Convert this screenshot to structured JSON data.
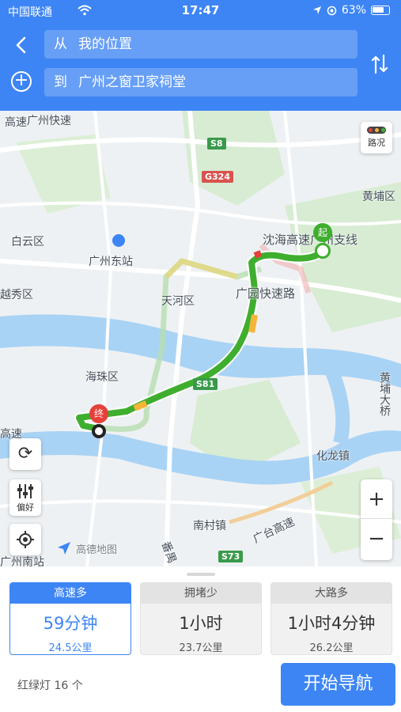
{
  "status_bar": {
    "carrier": "中国联通",
    "time": "17:47",
    "battery": "63%"
  },
  "route_input": {
    "from_prefix": "从",
    "from_value": "我的位置",
    "to_prefix": "到",
    "to_value": "广州之窗卫家祠堂"
  },
  "map": {
    "labels": [
      "高速",
      "广州快速",
      "S8",
      "G324",
      "黄埔区",
      "白云区",
      "广州东站",
      "沈海高速广州支线",
      "越秀区",
      "天河区",
      "广园快速路",
      "海珠区",
      "S81",
      "黄埔大桥",
      "化龙镇",
      "高速",
      "南村镇",
      "广台高速",
      "S73",
      "高德地图",
      "广州南站",
      "番禺"
    ],
    "start_marker": "起",
    "end_marker": "终",
    "traffic_button_label": "路况",
    "preference_button_label": "偏好",
    "zoom_in": "+",
    "zoom_out": "−",
    "colors": {
      "route_green": "#3fae2f",
      "route_slow": "#f4b53a",
      "route_jam": "#e5413a",
      "water": "#a9d3f5",
      "green_area": "#cfe8c9"
    }
  },
  "routes": [
    {
      "tag": "高速多",
      "duration": "59分钟",
      "distance": "24.5公里",
      "selected": true
    },
    {
      "tag": "拥堵少",
      "duration": "1小时",
      "distance": "23.7公里",
      "selected": false
    },
    {
      "tag": "大路多",
      "duration": "1小时4分钟",
      "distance": "26.2公里",
      "selected": false
    }
  ],
  "traffic_lights": "红绿灯 16 个",
  "start_nav_label": "开始导航",
  "accent_color": "#3d85f4"
}
